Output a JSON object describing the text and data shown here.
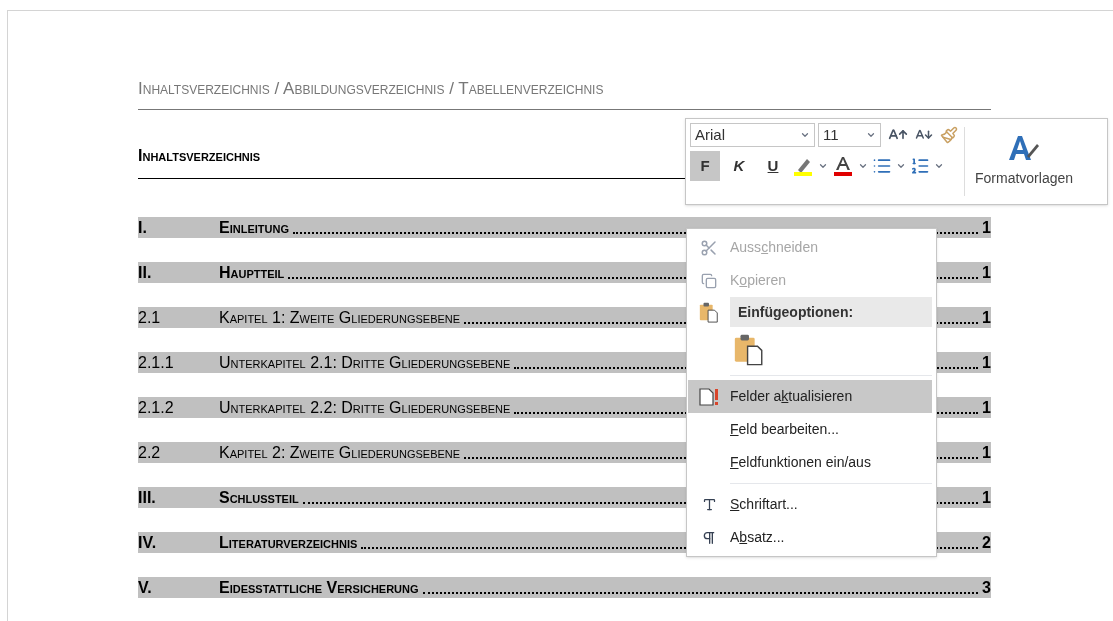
{
  "document": {
    "header": "Inhaltsverzeichnis / Abbildungsverzeichnis / Tabellenverzeichnis",
    "heading": "Inhaltsverzeichnis",
    "toc": [
      {
        "number": "I.",
        "title": "Einleitung",
        "page": "1",
        "kind": "chapter"
      },
      {
        "number": "II.",
        "title": "Hauptteil",
        "page": "1",
        "kind": "chapter"
      },
      {
        "number": "2.1",
        "title": "Kapitel 1: Zweite Gliederungsebene",
        "page": "1",
        "kind": "section"
      },
      {
        "number": "2.1.1",
        "title": "Unterkapitel 2.1: Dritte Gliederungsebene",
        "page": "1",
        "kind": "section"
      },
      {
        "number": "2.1.2",
        "title": "Unterkapitel 2.2: Dritte Gliederungsebene",
        "page": "1",
        "kind": "section"
      },
      {
        "number": "2.2",
        "title": "Kapitel 2: Zweite Gliederungsebene",
        "page": "1",
        "kind": "section"
      },
      {
        "number": "III.",
        "title": "Schlussteil",
        "page": "1",
        "kind": "chapter"
      },
      {
        "number": "IV.",
        "title": "Literaturverzeichnis",
        "page": "2",
        "kind": "chapter"
      },
      {
        "number": "V.",
        "title": "Eidesstattliche Versicherung",
        "page": "3",
        "kind": "chapter"
      }
    ]
  },
  "mini_toolbar": {
    "font": "Arial",
    "size": "11",
    "format_buttons": [
      {
        "label": "F",
        "kind": "bold",
        "selected": true
      },
      {
        "label": "K",
        "kind": "italic",
        "selected": false
      },
      {
        "label": "U",
        "kind": "underline",
        "selected": false
      }
    ],
    "styles_label": "Formatvorlagen"
  },
  "context_menu": {
    "items": [
      {
        "kind": "action",
        "label": {
          "pre": "Auss",
          "key": "c",
          "post": "hneiden"
        },
        "disabled": true,
        "selected": false
      },
      {
        "kind": "action",
        "label": {
          "pre": "K",
          "key": "o",
          "post": "pieren"
        },
        "disabled": true,
        "selected": false
      },
      {
        "kind": "header",
        "label": "Einfügeoptionen:"
      },
      {
        "kind": "paste_option"
      },
      {
        "kind": "separator"
      },
      {
        "kind": "action",
        "label": {
          "pre": "Felder a",
          "key": "k",
          "post": "tualisieren"
        },
        "disabled": false,
        "selected": true
      },
      {
        "kind": "action",
        "label": {
          "key": "F",
          "post": "eld bearbeiten..."
        },
        "disabled": false,
        "selected": false
      },
      {
        "kind": "action",
        "label": {
          "key": "F",
          "post": "eldfunktionen ein/aus"
        },
        "disabled": false,
        "selected": false
      },
      {
        "kind": "separator"
      },
      {
        "kind": "action",
        "label": {
          "key": "S",
          "post": "chriftart..."
        },
        "disabled": false,
        "selected": false
      },
      {
        "kind": "action",
        "label": {
          "pre": "A",
          "key": "b",
          "post": "satz..."
        },
        "disabled": false,
        "selected": false
      }
    ]
  }
}
